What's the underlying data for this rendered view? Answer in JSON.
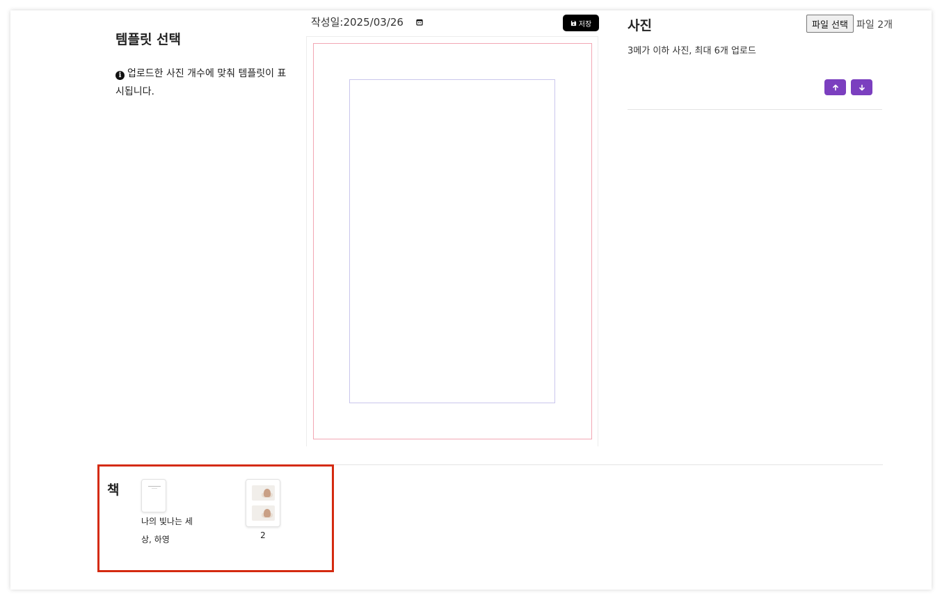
{
  "template_panel": {
    "title": "템플릿 선택",
    "info_text": "업로드한 사진 개수에 맞춰 템플릿이 표시됩니다."
  },
  "editor": {
    "date_label": "작성일:",
    "date_value": "2025/03/26",
    "save_label": "저장"
  },
  "photo_panel": {
    "title": "사진",
    "file_button_label": "파일 선택",
    "file_count": "파일 2개",
    "description": "3메가 이하 사진, 최대 6개 업로드"
  },
  "book": {
    "label": "책",
    "items": [
      {
        "caption": "나의 빛나는 세상, 하영"
      },
      {
        "caption": "2"
      }
    ]
  },
  "colors": {
    "accent": "#7b3fbf",
    "highlight_border": "#d42a10",
    "outer_rect": "#f2a6b3",
    "inner_rect": "#c9c6ec"
  }
}
